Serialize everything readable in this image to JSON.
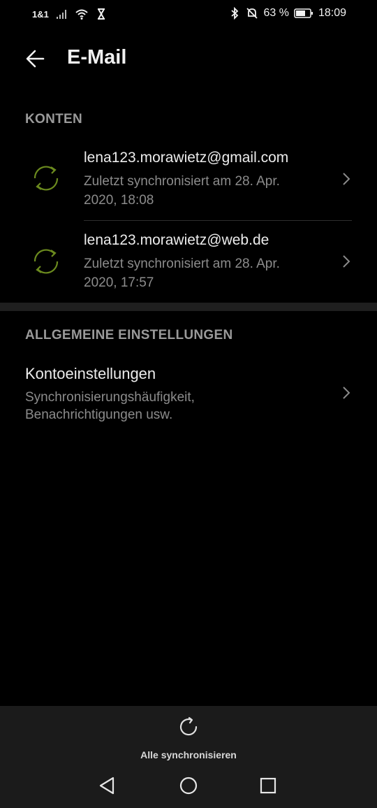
{
  "status_bar": {
    "carrier": "1&1",
    "battery_percent": "63 %",
    "time": "18:09"
  },
  "app_bar": {
    "title": "E-Mail"
  },
  "accounts_section": {
    "header": "KONTEN",
    "accounts": [
      {
        "email": "lena123.morawietz@gmail.com",
        "sync_line1": "Zuletzt synchronisiert am 28. Apr.",
        "sync_line2": "2020, 18:08"
      },
      {
        "email": "lena123.morawietz@web.de",
        "sync_line1": "Zuletzt synchronisiert am 28. Apr.",
        "sync_line2": "2020, 17:57"
      }
    ]
  },
  "general_section": {
    "header": "ALLGEMEINE EINSTELLUNGEN",
    "account_settings": {
      "title": "Kontoeinstellungen",
      "subtitle_line1": "Synchronisierungshäufigkeit,",
      "subtitle_line2": "Benachrichtigungen usw."
    }
  },
  "bottom_bar": {
    "sync_all_label": "Alle synchronisieren"
  },
  "colors": {
    "background": "#000000",
    "sync_icon": "#6b8a1e",
    "section_header": "#9a9a9a"
  },
  "icons": {
    "back": "arrow-left-icon",
    "account_sync": "sync-circle-icon",
    "chevron": "chevron-right-icon",
    "sync_all": "refresh-icon",
    "nav_back": "triangle-back-icon",
    "nav_home": "circle-home-icon",
    "nav_recent": "square-recents-icon"
  }
}
